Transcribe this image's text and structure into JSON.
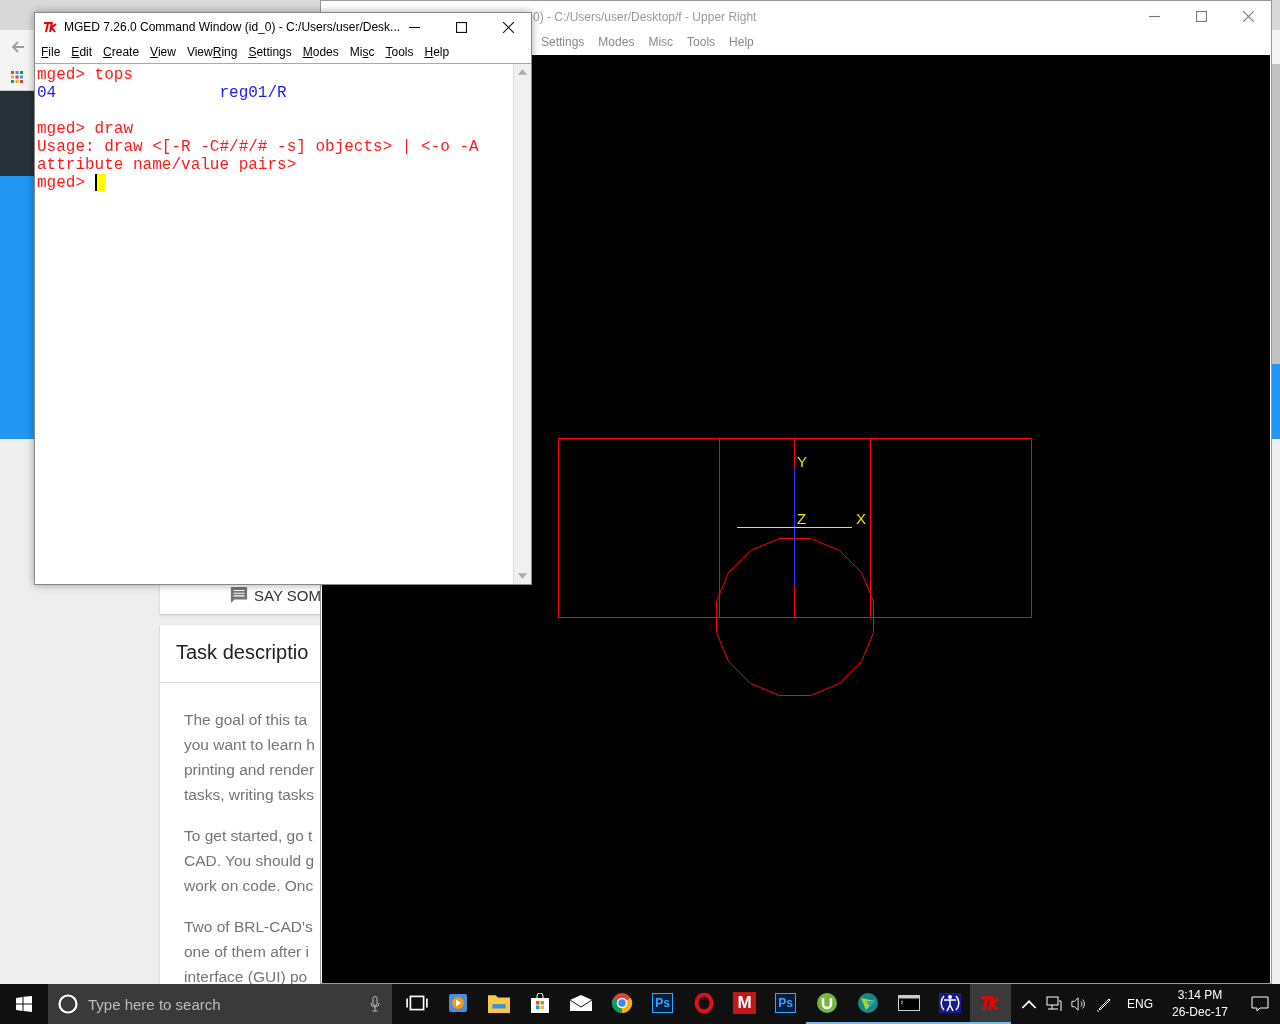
{
  "browser": {
    "comment_button": "SAY SOM",
    "task_card": {
      "title": "Task descriptio",
      "paragraphs": [
        [
          "The goal of this ta",
          "you want to learn h",
          "printing and render",
          "tasks, writing tasks"
        ],
        [
          "To get started, go t",
          "CAD. You should g",
          "work on code. Onc"
        ],
        [
          "Two of BRL-CAD's",
          "one of them after i",
          "interface (GUI) po"
        ]
      ]
    }
  },
  "graphics_window": {
    "title": "0) - C:/Users/user/Desktop/f - Upper Right",
    "menu": [
      "Settings",
      "Modes",
      "Misc",
      "Tools",
      "Help"
    ],
    "axis_labels": {
      "y": "Y",
      "z": "Z",
      "x": "X"
    }
  },
  "command_window": {
    "title": "MGED 7.26.0 Command Window (id_0) - C:/Users/user/Desk...",
    "menu": [
      {
        "key": "F",
        "after": "ile"
      },
      {
        "key": "E",
        "after": "dit"
      },
      {
        "key": "C",
        "after": "reate"
      },
      {
        "key": "V",
        "after": "iew"
      },
      {
        "before": "View",
        "key": "R",
        "after": "ing"
      },
      {
        "key": "S",
        "after": "ettings"
      },
      {
        "key": "M",
        "after": "odes"
      },
      {
        "before": "Mi",
        "key": "s",
        "after": "c"
      },
      {
        "key": "T",
        "after": "ools"
      },
      {
        "key": "H",
        "after": "elp"
      }
    ],
    "lines": [
      {
        "kind": "prompt",
        "text": "mged> tops"
      },
      {
        "kind": "output",
        "text": "04                 reg01/R"
      },
      {
        "kind": "blank"
      },
      {
        "kind": "prompt",
        "text": "mged> draw"
      },
      {
        "kind": "error",
        "text": "Usage: draw <[-R -C#/#/# -s] objects> | <-o -A"
      },
      {
        "kind": "error",
        "text": "attribute name/value pairs>"
      },
      {
        "kind": "input",
        "text": "mged>"
      }
    ]
  },
  "taskbar": {
    "search": {
      "placeholder": "Type here to search"
    },
    "apps": [
      {
        "kind": "taskview",
        "running": false,
        "selected": false
      },
      {
        "kind": "media",
        "running": false,
        "selected": false
      },
      {
        "kind": "folder",
        "running": false,
        "selected": false
      },
      {
        "kind": "store",
        "running": false,
        "selected": false
      },
      {
        "kind": "mail",
        "running": false,
        "selected": false
      },
      {
        "kind": "chrome",
        "running": false,
        "selected": false
      },
      {
        "kind": "ps",
        "label": "Ps",
        "running": false,
        "selected": false
      },
      {
        "kind": "opera",
        "running": false,
        "selected": false
      },
      {
        "kind": "mletter",
        "label": "M",
        "running": false,
        "selected": false
      },
      {
        "kind": "ps",
        "label": "Ps",
        "running": false,
        "selected": false
      },
      {
        "kind": "torrent",
        "running": true,
        "selected": false
      },
      {
        "kind": "globe",
        "running": true,
        "selected": false
      },
      {
        "kind": "console",
        "running": true,
        "selected": false
      },
      {
        "kind": "person",
        "running": true,
        "selected": false
      },
      {
        "kind": "tk",
        "running": true,
        "selected": true
      }
    ],
    "language": "ENG",
    "time": "3:14 PM",
    "date": "26-Dec-17"
  }
}
